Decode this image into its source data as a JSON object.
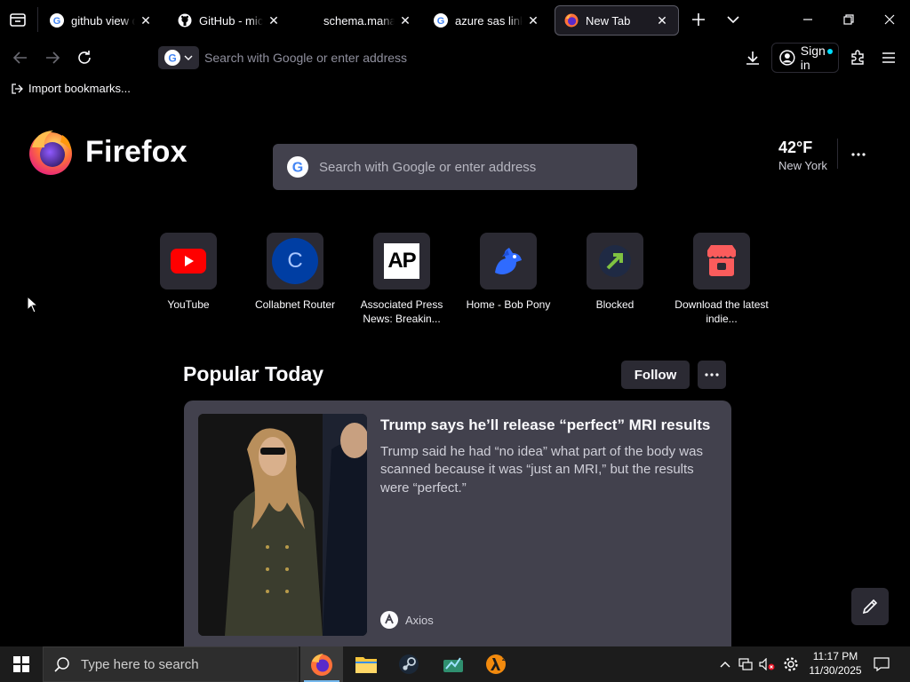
{
  "tabs": [
    {
      "title": "github view dele",
      "favicon": "google-g-icon",
      "active": false
    },
    {
      "title": "GitHub - micros",
      "favicon": "github-icon",
      "active": false
    },
    {
      "title": "schema.manage",
      "favicon": "none",
      "active": false
    },
    {
      "title": "azure sas link ex",
      "favicon": "google-g-icon",
      "active": false
    },
    {
      "title": "New Tab",
      "favicon": "firefox-icon",
      "active": true
    }
  ],
  "urlbar": {
    "placeholder": "Search with Google or enter address"
  },
  "signin": {
    "label": "Sign in"
  },
  "bookmarks": {
    "import_label": "Import bookmarks..."
  },
  "ntp": {
    "logo_text": "Firefox",
    "search_placeholder": "Search with Google or enter address",
    "weather": {
      "temp": "42°F",
      "city": "New York"
    },
    "top_sites": [
      {
        "label": "YouTube",
        "icon": "youtube-icon"
      },
      {
        "label": "Collabnet Router",
        "icon": "letter-c-icon",
        "letter": "C"
      },
      {
        "label": "Associated Press News: Breakin...",
        "icon": "ap-logo-icon",
        "letter": "AP"
      },
      {
        "label": "Home - Bob Pony",
        "icon": "bob-pony-icon"
      },
      {
        "label": "Blocked",
        "icon": "blocked-arrow-icon"
      },
      {
        "label": "Download the latest indie...",
        "icon": "itch-io-icon"
      }
    ],
    "popular": {
      "heading": "Popular Today",
      "follow_label": "Follow",
      "story": {
        "title": "Trump says he’ll release “perfect” MRI results",
        "excerpt": "Trump said he had “no idea” what part of the body was scanned because it was “just an MRI,” but the results were “perfect.”",
        "source": "Axios"
      }
    }
  },
  "taskbar": {
    "search_placeholder": "Type here to search",
    "time": "11:17 PM",
    "date": "11/30/2025",
    "apps": [
      "firefox-icon",
      "file-explorer-icon",
      "steam-icon",
      "app-icon",
      "half-life-icon"
    ]
  },
  "colors": {
    "accent": "#00ddff",
    "card": "#42414d",
    "tile": "#2b2a33",
    "youtube": "#ff0000",
    "itch": "#fa5c5c"
  }
}
